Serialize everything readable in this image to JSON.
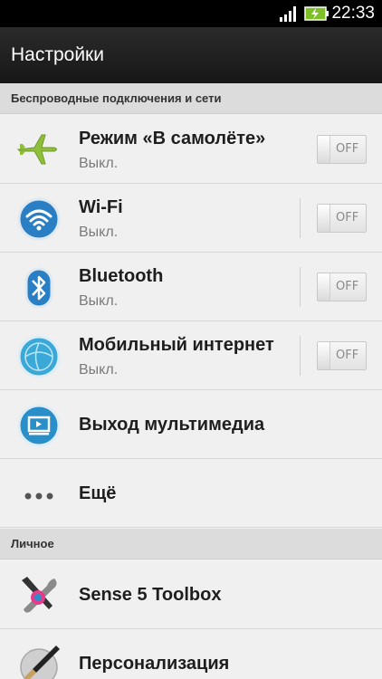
{
  "status_bar": {
    "time": "22:33",
    "signal_icon": "signal-bars-icon",
    "battery_icon": "battery-charging-icon"
  },
  "app_bar": {
    "title": "Настройки"
  },
  "sections": [
    {
      "header": "Беспроводные подключения и сети"
    },
    {
      "header": "Личное"
    }
  ],
  "rows": [
    {
      "label": "Режим «В самолёте»",
      "sub": "Выкл.",
      "icon": "airplane-icon",
      "toggle": "OFF"
    },
    {
      "label": "Wi-Fi",
      "sub": "Выкл.",
      "icon": "wifi-icon",
      "toggle": "OFF"
    },
    {
      "label": "Bluetooth",
      "sub": "Выкл.",
      "icon": "bluetooth-icon",
      "toggle": "OFF"
    },
    {
      "label": "Мобильный интернет",
      "sub": "Выкл.",
      "icon": "mobile-data-globe-icon",
      "toggle": "OFF"
    },
    {
      "label": "Выход мультимедиа",
      "icon": "media-output-icon"
    },
    {
      "label": "Ещё",
      "icon": "more-dots-icon"
    },
    {
      "label": "Sense 5 Toolbox",
      "icon": "toolbox-icon"
    },
    {
      "label": "Персонализация",
      "icon": "personalization-brush-icon"
    }
  ],
  "colors": {
    "accent_blue": "#2a7fc4",
    "airplane_green": "#8fbf3a",
    "background": "#f0f0f0"
  }
}
